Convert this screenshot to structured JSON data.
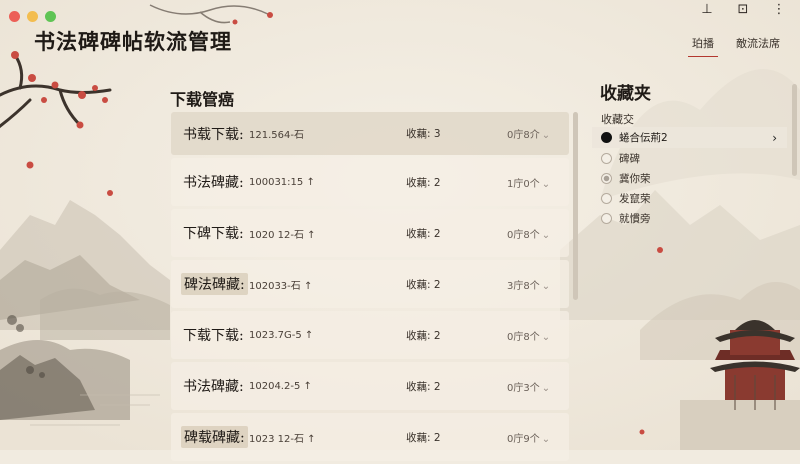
{
  "window": {
    "title": "书法碑碑帖软流管理"
  },
  "header": {
    "tabs": [
      {
        "label": "珀播",
        "active": true
      },
      {
        "label": "敵流法席",
        "active": false
      }
    ]
  },
  "downloads": {
    "title": "下载管癌",
    "items": [
      {
        "name": "书载下载:",
        "size": "121.564-石",
        "count": "收藕: 3",
        "progress": "0庁8介",
        "chevron": "⌄"
      },
      {
        "name": "书法碑藏:",
        "size": "100031:15 ↑",
        "count": "收藕: 2",
        "progress": "1庁0个",
        "chevron": "⌄"
      },
      {
        "name": "下碑下载:",
        "size": "1020 12-石 ↑",
        "count": "收藕: 2",
        "progress": "0庁8个",
        "chevron": "⌄"
      },
      {
        "name": "碑法碑藏:",
        "size": "102033-石 ↑",
        "count": "收藕: 2",
        "progress": "3庁8个",
        "chevron": "⌄"
      },
      {
        "name": "下载下载:",
        "size": "1023.7G-5 ↑",
        "count": "收藕: 2",
        "progress": "0庁8个",
        "chevron": "⌄"
      },
      {
        "name": "书法碑藏:",
        "size": "10204.2-5 ↑",
        "count": "收藕: 2",
        "progress": "0庁3个",
        "chevron": "⌄"
      },
      {
        "name": "碑载碑藏:",
        "size": "1023 12-石 ↑",
        "count": "收藕: 2",
        "progress": "0庁9个",
        "chevron": "⌄"
      }
    ]
  },
  "favorites": {
    "title": "收藏夹",
    "subtitle": "收藏交",
    "items": [
      {
        "label": "蜷合伝荊2",
        "state": "selected"
      },
      {
        "label": "碑碑",
        "state": "empty"
      },
      {
        "label": "冀你荣",
        "state": "dot"
      },
      {
        "label": "发竄荣",
        "state": "empty"
      },
      {
        "label": "就慣旁",
        "state": "empty"
      }
    ],
    "arrow": "›"
  },
  "icons": {
    "top": [
      "pin-icon",
      "chat-icon",
      "ellipsis-icon"
    ],
    "top_glyphs": [
      "⊥",
      "⊡",
      "⋮"
    ]
  },
  "colors": {
    "background": "#f1ebe0",
    "accent": "#b3382f",
    "selected_row": "#e2d9ca"
  }
}
